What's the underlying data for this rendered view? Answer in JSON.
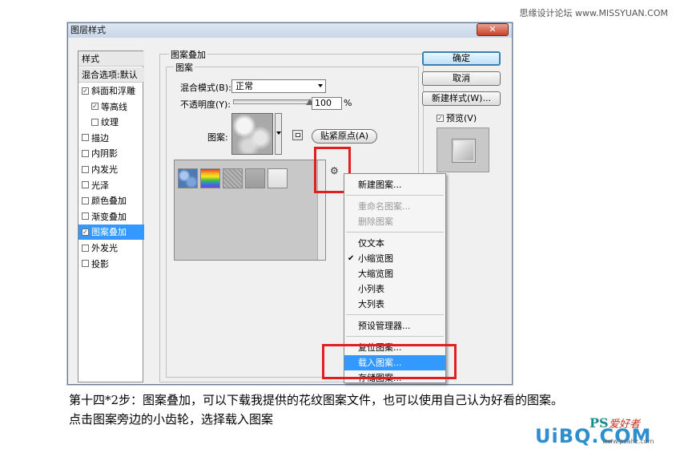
{
  "watermark_top": "思缘设计论坛 www.MISSYUAN.COM",
  "dialog": {
    "title": "图层样式",
    "close_icon": "close-icon"
  },
  "left_panel": {
    "items": [
      {
        "label": "样式",
        "type": "header"
      },
      {
        "label": "混合选项:默认",
        "type": "header"
      },
      {
        "label": "斜面和浮雕",
        "checked": true
      },
      {
        "label": "等高线",
        "checked": true,
        "indent": true
      },
      {
        "label": "纹理",
        "checked": false,
        "indent": true
      },
      {
        "label": "描边",
        "checked": false
      },
      {
        "label": "内阴影",
        "checked": false
      },
      {
        "label": "内发光",
        "checked": false
      },
      {
        "label": "光泽",
        "checked": false
      },
      {
        "label": "颜色叠加",
        "checked": false
      },
      {
        "label": "渐变叠加",
        "checked": false
      },
      {
        "label": "图案叠加",
        "checked": true,
        "selected": true
      },
      {
        "label": "外发光",
        "checked": false
      },
      {
        "label": "投影",
        "checked": false
      }
    ]
  },
  "pattern_overlay": {
    "group_title": "图案叠加",
    "subgroup_title": "图案",
    "blend_mode_label": "混合模式(B):",
    "blend_mode_value": "正常",
    "opacity_label": "不透明度(Y):",
    "opacity_value": "100",
    "opacity_unit": "%",
    "opacity_fraction": 1.0,
    "pattern_label": "图案:",
    "snap_origin_button": "贴紧原点(A)"
  },
  "buttons": {
    "ok": "确定",
    "cancel": "取消",
    "new_style": "新建样式(W)...",
    "preview_label": "预览(V)",
    "preview_checked": true
  },
  "gear_icon": "⚙",
  "context_menu": {
    "items": [
      {
        "label": "新建图案...",
        "state": "normal"
      },
      {
        "type": "separator"
      },
      {
        "label": "重命名图案...",
        "state": "disabled"
      },
      {
        "label": "删除图案",
        "state": "disabled"
      },
      {
        "type": "separator"
      },
      {
        "label": "仅文本",
        "state": "normal"
      },
      {
        "label": "小缩览图",
        "state": "normal",
        "checked": true
      },
      {
        "label": "大缩览图",
        "state": "normal"
      },
      {
        "label": "小列表",
        "state": "normal"
      },
      {
        "label": "大列表",
        "state": "normal"
      },
      {
        "type": "separator"
      },
      {
        "label": "预设管理器...",
        "state": "normal"
      },
      {
        "type": "separator"
      },
      {
        "label": "复位图案...",
        "state": "normal"
      },
      {
        "label": "载入图案...",
        "state": "highlight"
      },
      {
        "label": "存储图案...",
        "state": "normal"
      }
    ]
  },
  "caption": {
    "line1": "第十四*2步：图案叠加，可以下载我提供的花纹图案文件，也可以使用自己认为好看的图案。",
    "line2": "点击图案旁边的小齿轮，选择载入图案"
  },
  "logos": {
    "ps": "PS",
    "ps_sub": "爱好者",
    "big": "UiBQ.COM",
    "url": "www.psahz.com"
  }
}
